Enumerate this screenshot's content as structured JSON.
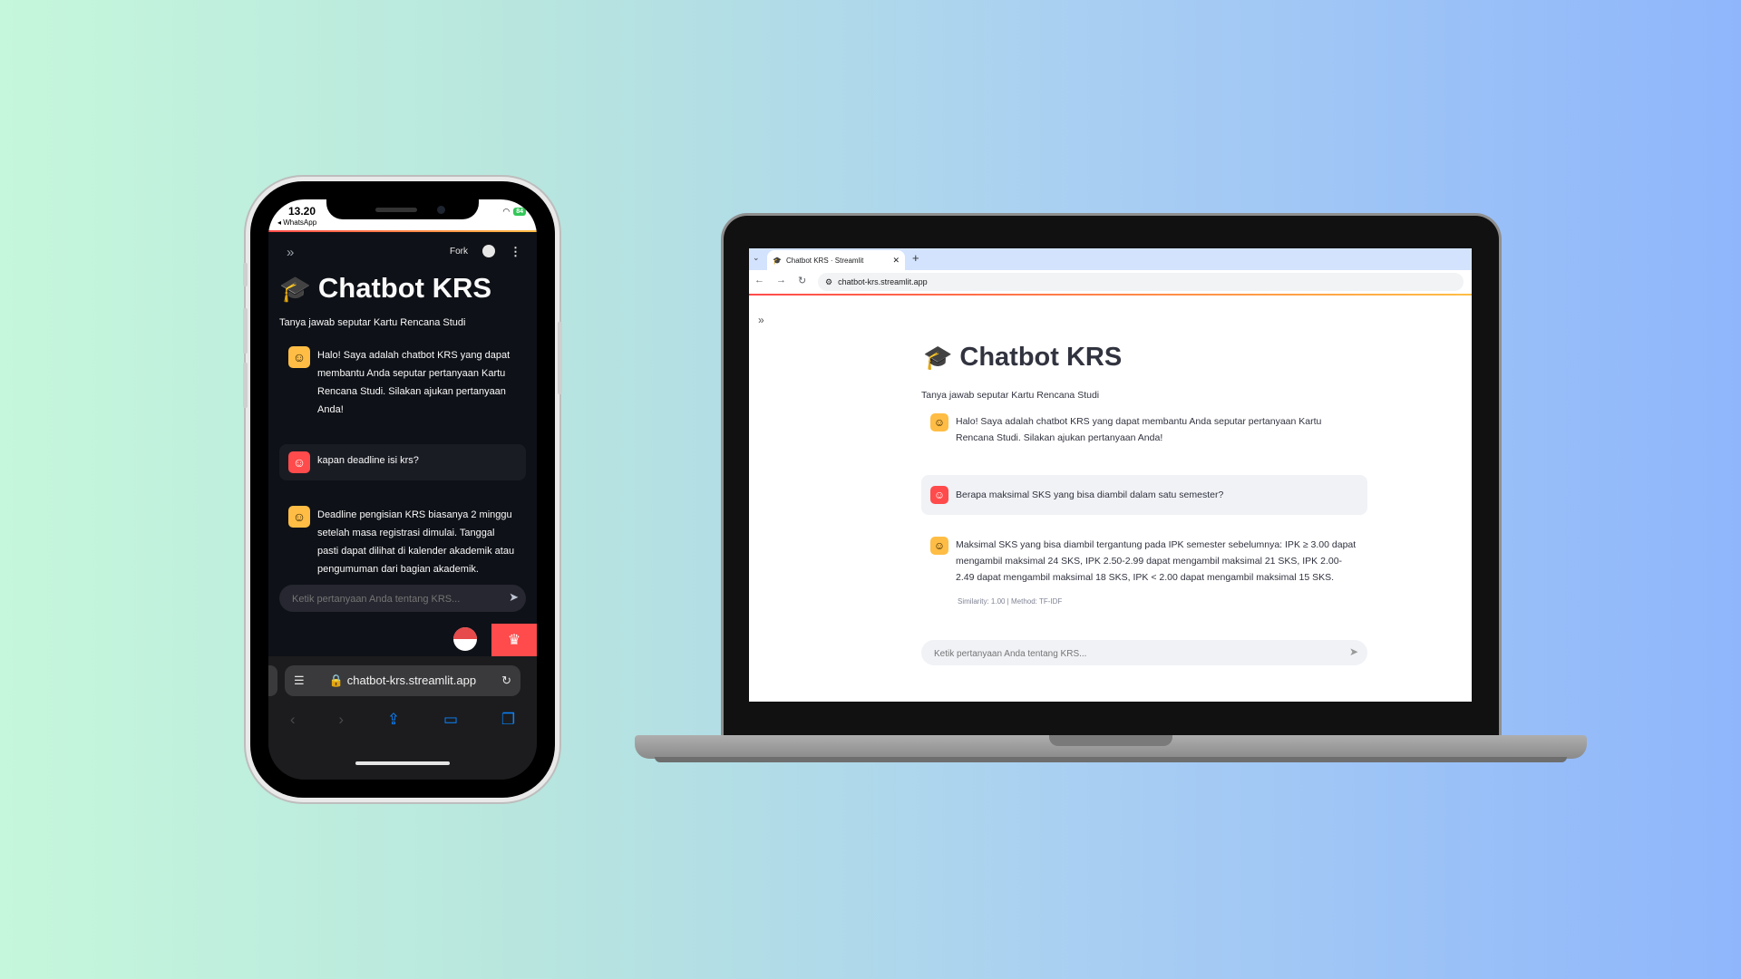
{
  "phone": {
    "status": {
      "time": "13.20",
      "back_app": "◂ WhatsApp",
      "battery": "84"
    },
    "header": {
      "fork_label": "Fork"
    },
    "app": {
      "title": "Chatbot KRS",
      "subtitle": "Tanya jawab seputar Kartu Rencana Studi",
      "messages": [
        {
          "role": "assistant",
          "text": "Halo! Saya adalah chatbot KRS yang dapat membantu Anda seputar pertanyaan Kartu Rencana Studi. Silakan ajukan pertanyaan Anda!"
        },
        {
          "role": "user",
          "text": "kapan deadline isi krs?"
        },
        {
          "role": "assistant",
          "text": "Deadline pengisian KRS biasanya 2 minggu setelah masa registrasi dimulai. Tanggal pasti dapat dilihat di kalender akademik atau pengumuman dari bagian akademik."
        }
      ],
      "input_placeholder": "Ketik pertanyaan Anda tentang KRS..."
    },
    "browser": {
      "url": "chatbot-krs.streamlit.app"
    }
  },
  "laptop": {
    "browser": {
      "tab_title": "Chatbot KRS · Streamlit",
      "url": "chatbot-krs.streamlit.app"
    },
    "app": {
      "title": "Chatbot KRS",
      "subtitle": "Tanya jawab seputar Kartu Rencana Studi",
      "messages": [
        {
          "role": "assistant",
          "text": "Halo! Saya adalah chatbot KRS yang dapat membantu Anda seputar pertanyaan Kartu Rencana Studi. Silakan ajukan pertanyaan Anda!"
        },
        {
          "role": "user",
          "text": "Berapa maksimal SKS yang bisa diambil dalam satu semester?"
        },
        {
          "role": "assistant",
          "text": "Maksimal SKS yang bisa diambil tergantung pada IPK semester sebelumnya: IPK ≥ 3.00 dapat mengambil maksimal 24 SKS, IPK 2.50-2.99 dapat mengambil maksimal 21 SKS, IPK 2.00-2.49 dapat mengambil maksimal 18 SKS, IPK < 2.00 dapat mengambil maksimal 15 SKS."
        }
      ],
      "similarity_note": "Similarity: 1.00 | Method: TF-IDF",
      "input_placeholder": "Ketik pertanyaan Anda tentang KRS..."
    }
  },
  "icons": {
    "graduation_cap": "🎓",
    "bot_avatar": "☺",
    "user_avatar": "☺",
    "send": "➤",
    "sidebar_toggle": "»",
    "more": "⋮",
    "crown": "♛"
  },
  "colors": {
    "accent_red": "#ff4b4b",
    "accent_yellow": "#ffbd45",
    "dark_bg": "#0e1117",
    "light_bg": "#ffffff"
  }
}
